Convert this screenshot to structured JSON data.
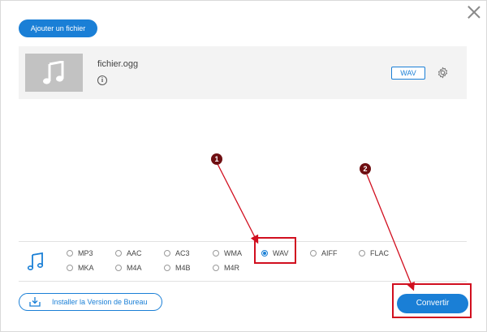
{
  "dialog": {
    "add_file_label": "Ajouter un fichier"
  },
  "file": {
    "name": "fichier.ogg",
    "info_icon_glyph": "i",
    "format": "WAV",
    "icons": [
      "music-note-icon",
      "info-icon",
      "gear-icon"
    ]
  },
  "formats": {
    "row1": [
      "MP3",
      "AAC",
      "AC3",
      "WMA",
      "WAV",
      "AIFF",
      "FLAC"
    ],
    "row2": [
      "MKA",
      "M4A",
      "M4B",
      "M4R"
    ],
    "selected": "WAV"
  },
  "footer": {
    "install_label": "Installer la Version de Bureau",
    "convert_label": "Convertir"
  },
  "annotations": {
    "step1": "1",
    "step2": "2",
    "color": "#d10f1f"
  },
  "colors": {
    "accent": "#1a7fd6",
    "annotation_red": "#d10f1f",
    "badge_dark": "#6f0f12"
  }
}
